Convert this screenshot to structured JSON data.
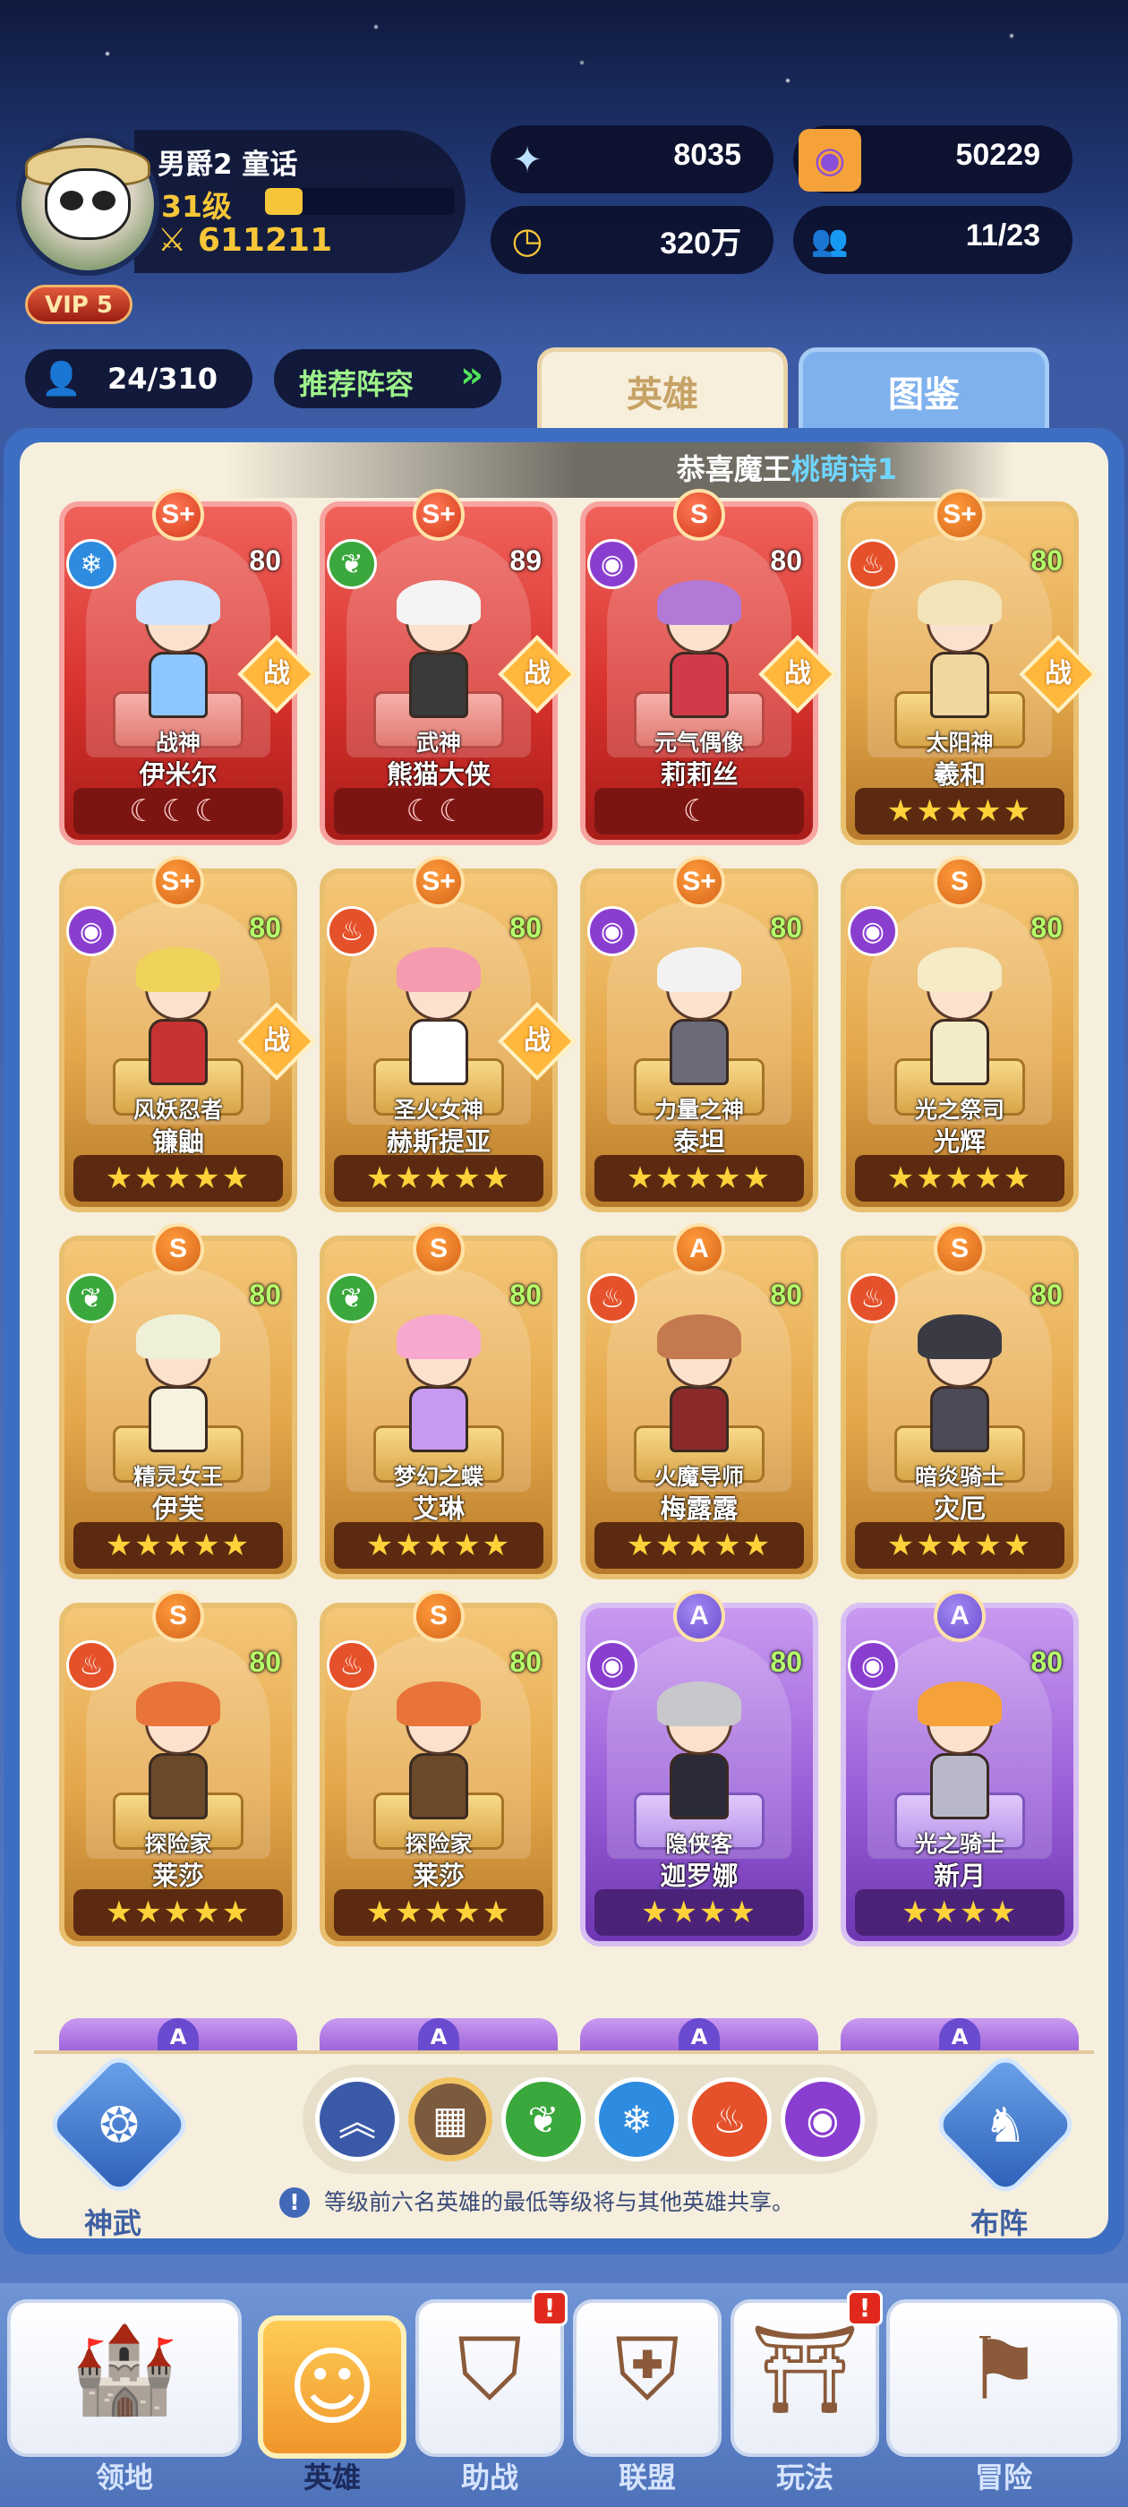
{
  "player": {
    "name": "男爵2 童话",
    "level_label": "31级",
    "level_progress_pct": 20,
    "power": "611211",
    "vip": "VIP 5"
  },
  "resources": [
    {
      "icon": "diamond-icon",
      "value": "8035"
    },
    {
      "icon": "purple-coin-icon",
      "value": "50229"
    },
    {
      "icon": "gold-coin-icon",
      "value": "320万"
    },
    {
      "icon": "friends-icon",
      "value": "11/23"
    }
  ],
  "hero_count": "24/310",
  "recommend_label": "推荐阵容",
  "tabs": {
    "hero": "英雄",
    "codex": "图鉴"
  },
  "notice": {
    "prefix": "恭喜魔王",
    "highlight": "桃萌诗1"
  },
  "heroes": [
    {
      "grade": "S+",
      "tier": "SP",
      "element": "water",
      "level": "80",
      "title": "战神",
      "name": "伊米尔",
      "battle": "战",
      "rank": "☾☾☾"
    },
    {
      "grade": "S+",
      "tier": "SP",
      "element": "nature",
      "level": "89",
      "title": "武神",
      "name": "熊猫大侠",
      "battle": "战",
      "rank": "☾☾"
    },
    {
      "grade": "S",
      "tier": "SP",
      "element": "dark",
      "level": "80",
      "title": "元气偶像",
      "name": "莉莉丝",
      "battle": "战",
      "rank": "☾"
    },
    {
      "grade": "S+",
      "tier": "S",
      "element": "fire",
      "level": "80",
      "title": "太阳神",
      "name": "羲和",
      "battle": "战",
      "rank": "★★★★★"
    },
    {
      "grade": "S+",
      "tier": "S",
      "element": "dark",
      "level": "80",
      "title": "风妖忍者",
      "name": "镰鼬",
      "battle": "战",
      "rank": "★★★★★"
    },
    {
      "grade": "S+",
      "tier": "S",
      "element": "fire",
      "level": "80",
      "title": "圣火女神",
      "name": "赫斯提亚",
      "battle": "战",
      "rank": "★★★★★"
    },
    {
      "grade": "S+",
      "tier": "S",
      "element": "dark",
      "level": "80",
      "title": "力量之神",
      "name": "泰坦",
      "battle": "",
      "rank": "★★★★★"
    },
    {
      "grade": "S",
      "tier": "S",
      "element": "dark",
      "level": "80",
      "title": "光之祭司",
      "name": "光辉",
      "battle": "",
      "rank": "★★★★★"
    },
    {
      "grade": "S",
      "tier": "S",
      "element": "nature",
      "level": "80",
      "title": "精灵女王",
      "name": "伊芙",
      "battle": "",
      "rank": "★★★★★"
    },
    {
      "grade": "S",
      "tier": "S",
      "element": "nature",
      "level": "80",
      "title": "梦幻之蝶",
      "name": "艾琳",
      "battle": "",
      "rank": "★★★★★"
    },
    {
      "grade": "A",
      "tier": "S",
      "element": "fire",
      "level": "80",
      "title": "火魔导师",
      "name": "梅露露",
      "battle": "",
      "rank": "★★★★★"
    },
    {
      "grade": "S",
      "tier": "S",
      "element": "fire",
      "level": "80",
      "title": "暗炎骑士",
      "name": "灾厄",
      "battle": "",
      "rank": "★★★★★"
    },
    {
      "grade": "S",
      "tier": "S",
      "element": "fire",
      "level": "80",
      "title": "探险家",
      "name": "莱莎",
      "battle": "",
      "rank": "★★★★★"
    },
    {
      "grade": "S",
      "tier": "S",
      "element": "fire",
      "level": "80",
      "title": "探险家",
      "name": "莱莎",
      "battle": "",
      "rank": "★★★★★"
    },
    {
      "grade": "A",
      "tier": "A",
      "element": "dark",
      "level": "80",
      "title": "隐侠客",
      "name": "迦罗娜",
      "battle": "",
      "rank": "★★★★"
    },
    {
      "grade": "A",
      "tier": "A",
      "element": "dark",
      "level": "80",
      "title": "光之骑士",
      "name": "新月",
      "battle": "",
      "rank": "★★★★"
    }
  ],
  "peek_grades": [
    "A",
    "A",
    "A",
    "A"
  ],
  "side_buttons": {
    "left": "神武",
    "right": "布阵"
  },
  "filters": [
    {
      "icon": "sort-up-icon",
      "color": "#3a5aa8"
    },
    {
      "icon": "grid-all-icon",
      "color": "#7b5a3e"
    },
    {
      "icon": "nature-element-icon",
      "color": "#3aa83c"
    },
    {
      "icon": "water-element-icon",
      "color": "#2d8be0"
    },
    {
      "icon": "fire-element-icon",
      "color": "#e5512a"
    },
    {
      "icon": "dark-element-icon",
      "color": "#8a3ed0"
    }
  ],
  "hint": "等级前六名英雄的最低等级将与其他英雄共享。",
  "nav": [
    {
      "label": "领地",
      "icon": "castle-icon",
      "badge": ""
    },
    {
      "label": "英雄",
      "icon": "hero-face-icon",
      "badge": ""
    },
    {
      "label": "助战",
      "icon": "helmet-icon",
      "badge": "!"
    },
    {
      "label": "联盟",
      "icon": "shield-icon",
      "badge": ""
    },
    {
      "label": "玩法",
      "icon": "gate-icon",
      "badge": "!"
    },
    {
      "label": "冒险",
      "icon": "flag-icon",
      "badge": ""
    }
  ]
}
